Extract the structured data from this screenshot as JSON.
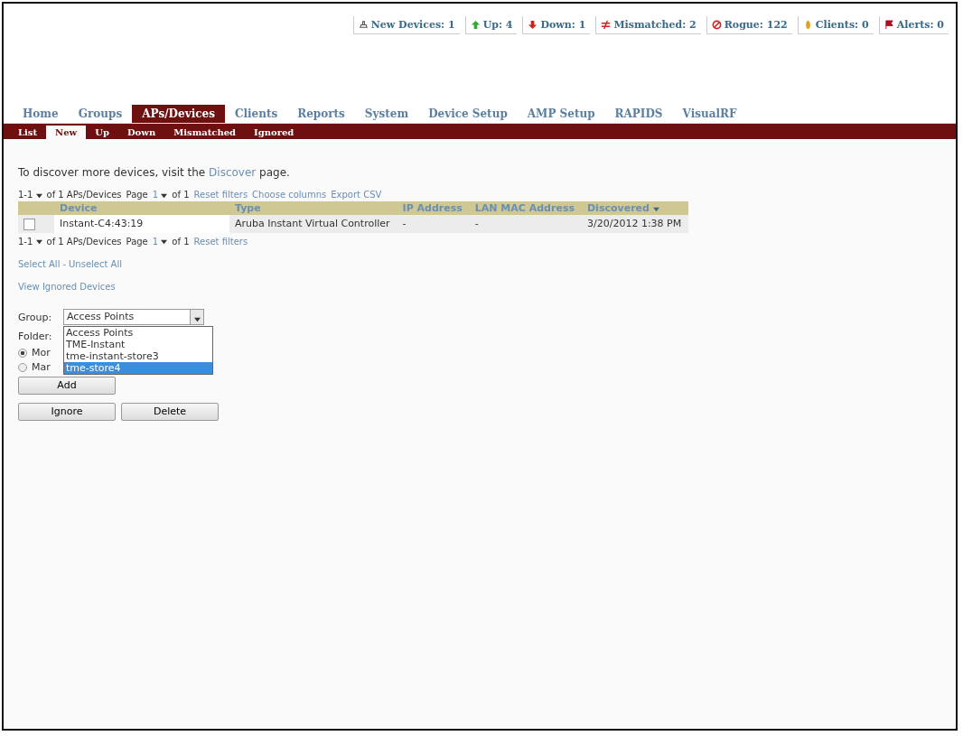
{
  "status": [
    {
      "kind": "new",
      "label": "New Devices: 1"
    },
    {
      "kind": "up",
      "label": "Up: 4"
    },
    {
      "kind": "down",
      "label": "Down: 1"
    },
    {
      "kind": "mismatched",
      "label": "Mismatched: 2"
    },
    {
      "kind": "rogue",
      "label": "Rogue: 122"
    },
    {
      "kind": "clients",
      "label": "Clients: 0"
    },
    {
      "kind": "alerts",
      "label": "Alerts: 0"
    }
  ],
  "tabs": [
    {
      "label": "Home",
      "selected": false
    },
    {
      "label": "Groups",
      "selected": false
    },
    {
      "label": "APs/Devices",
      "selected": true
    },
    {
      "label": "Clients",
      "selected": false
    },
    {
      "label": "Reports",
      "selected": false
    },
    {
      "label": "System",
      "selected": false
    },
    {
      "label": "Device Setup",
      "selected": false
    },
    {
      "label": "AMP Setup",
      "selected": false
    },
    {
      "label": "RAPIDS",
      "selected": false
    },
    {
      "label": "VisualRF",
      "selected": false
    }
  ],
  "subtabs": [
    {
      "label": "List",
      "selected": false
    },
    {
      "label": "New",
      "selected": true
    },
    {
      "label": "Up",
      "selected": false
    },
    {
      "label": "Down",
      "selected": false
    },
    {
      "label": "Mismatched",
      "selected": false
    },
    {
      "label": "Ignored",
      "selected": false
    }
  ],
  "intro": {
    "before": "To discover more devices, visit the",
    "link": "Discover",
    "after": "page."
  },
  "pager_top": {
    "range": "1-1",
    "of_total": "of 1 APs/Devices",
    "page_label": "Page",
    "page": "1",
    "of_pages": "of 1",
    "links": [
      "Reset filters",
      "Choose columns",
      "Export CSV"
    ]
  },
  "table": {
    "columns": [
      "Device",
      "Type",
      "IP Address",
      "LAN MAC Address",
      "Discovered"
    ],
    "rows": [
      {
        "checked": false,
        "cells": [
          "Instant-C4:43:19",
          "Aruba Instant Virtual Controller",
          "-",
          "-",
          "3/20/2012 1:38 PM"
        ]
      }
    ]
  },
  "pager_bottom": {
    "range": "1-1",
    "of_total": "of 1 APs/Devices",
    "page_label": "Page",
    "page": "1",
    "of_pages": "of 1",
    "links": [
      "Reset filters"
    ]
  },
  "select_links": {
    "select": "Select All",
    "sep": "-",
    "unselect": "Unselect All"
  },
  "view_ignored": "View Ignored Devices",
  "group": {
    "label": "Group:",
    "value": "Access Points",
    "options": [
      {
        "label": "Access Points",
        "highlighted": false
      },
      {
        "label": "TME-Instant",
        "highlighted": false
      },
      {
        "label": "tme-instant-store3",
        "highlighted": false
      },
      {
        "label": "tme-store4",
        "highlighted": true
      }
    ]
  },
  "folder": {
    "label": "Folder:"
  },
  "modes": [
    {
      "label": "Mor",
      "selected": true
    },
    {
      "label": "Mar",
      "selected": false
    }
  ],
  "add_button": "Add",
  "buttons": [
    "Ignore",
    "Delete"
  ]
}
